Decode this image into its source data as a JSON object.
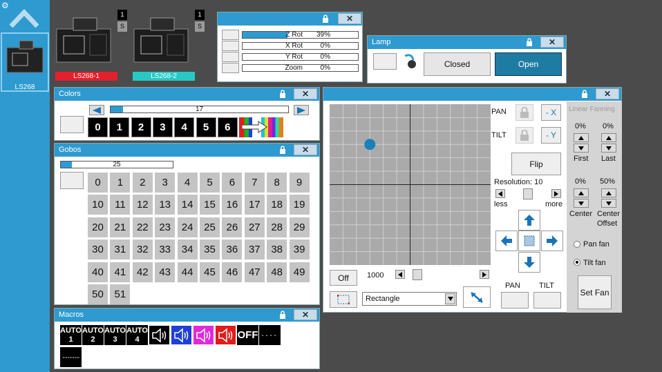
{
  "sidebar": {
    "fixture_label": "LS268"
  },
  "fixtures": [
    {
      "label": "LS268-1",
      "badge_num": "1",
      "badge_s": "S",
      "color": "#e3202d"
    },
    {
      "label": "LS268-2",
      "badge_num": "1",
      "badge_s": "S",
      "color": "#28c9c4"
    }
  ],
  "rot_panel": {
    "rows": [
      {
        "name": "Z Rot",
        "value": "39%",
        "fill": 0.39
      },
      {
        "name": "X Rot",
        "value": "0%",
        "fill": 0
      },
      {
        "name": "Y Rot",
        "value": "0%",
        "fill": 0
      },
      {
        "name": "Zoom",
        "value": "0%",
        "fill": 0
      }
    ]
  },
  "lamp": {
    "title": "Lamp",
    "closed_label": "Closed",
    "open_label": "Open"
  },
  "colors": {
    "title": "Colors",
    "slider_value": "17",
    "slider_fill": 0.07,
    "cells": [
      "0",
      "1",
      "2",
      "3",
      "4",
      "5",
      "6"
    ]
  },
  "gobos": {
    "title": "Gobos",
    "slider_value": "25",
    "slider_fill": 0.1,
    "cells": [
      "0",
      "1",
      "2",
      "3",
      "4",
      "5",
      "6",
      "7",
      "8",
      "9",
      "10",
      "11",
      "12",
      "13",
      "14",
      "15",
      "16",
      "17",
      "18",
      "19",
      "20",
      "21",
      "22",
      "23",
      "24",
      "25",
      "26",
      "27",
      "28",
      "29",
      "30",
      "31",
      "32",
      "33",
      "34",
      "35",
      "36",
      "37",
      "38",
      "39",
      "40",
      "41",
      "42",
      "43",
      "44",
      "45",
      "46",
      "47",
      "48",
      "49",
      "50",
      "51"
    ]
  },
  "macros": {
    "title": "Macros",
    "auto": [
      {
        "top": "AUTO",
        "num": "1"
      },
      {
        "top": "AUTO",
        "num": "2"
      },
      {
        "top": "AUTO",
        "num": "3"
      },
      {
        "top": "AUTO",
        "num": "4"
      }
    ],
    "sound_colors": [
      "#000000",
      "#1f3fd6",
      "#e02ad8",
      "#e01b1b"
    ],
    "off_label": "OFF"
  },
  "position": {
    "pan_label": "PAN",
    "tilt_label": "TILT",
    "minus_x": "- X",
    "minus_y": "- Y",
    "flip_label": "Flip",
    "resolution_label": "Resolution: 10",
    "less_label": "less",
    "more_label": "more",
    "off_label": "Off",
    "speed_value": "1000",
    "shape_value": "Rectangle",
    "pan_bottom_label": "PAN",
    "tilt_bottom_label": "TILT",
    "fan_title": "Linear Fanning",
    "first_value": "0%",
    "last_value": "0%",
    "first_label": "First",
    "last_label": "Last",
    "center_value": "0%",
    "offset_value": "50%",
    "center_label": "Center",
    "offset_label1": "Center",
    "offset_label2": "Offset",
    "pan_fan_label": "Pan fan",
    "tilt_fan_label": "Tilt fan",
    "set_fan_label": "Set Fan",
    "dot_x": 0.25,
    "dot_y": 0.25
  },
  "colors_theme": {
    "accent": "#2e9ad0"
  }
}
